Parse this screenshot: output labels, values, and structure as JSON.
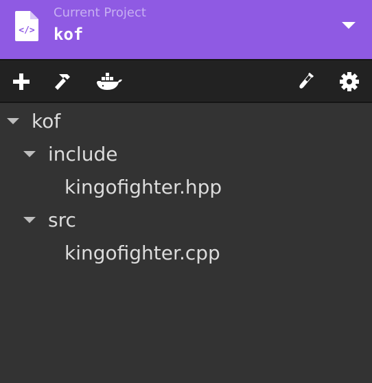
{
  "header": {
    "subtitle": "Current Project",
    "project_name": "kof",
    "icon": "code-file-icon",
    "dropdown_icon": "chevron-down-icon",
    "bg_color": "#8f5ae3"
  },
  "toolbar": {
    "left_tools": [
      {
        "name": "add-button",
        "icon": "plus-icon"
      },
      {
        "name": "build-button",
        "icon": "hammer-icon"
      },
      {
        "name": "docker-button",
        "icon": "docker-icon"
      }
    ],
    "right_tools": [
      {
        "name": "test-button",
        "icon": "test-tube-icon"
      },
      {
        "name": "settings-button",
        "icon": "gear-icon"
      }
    ]
  },
  "tree": {
    "root": {
      "label": "kof",
      "expanded": true
    },
    "include_folder": {
      "label": "include",
      "expanded": true
    },
    "include_file": {
      "label": "kingofighter.hpp"
    },
    "src_folder": {
      "label": "src",
      "expanded": true
    },
    "src_file": {
      "label": "kingofighter.cpp"
    }
  }
}
